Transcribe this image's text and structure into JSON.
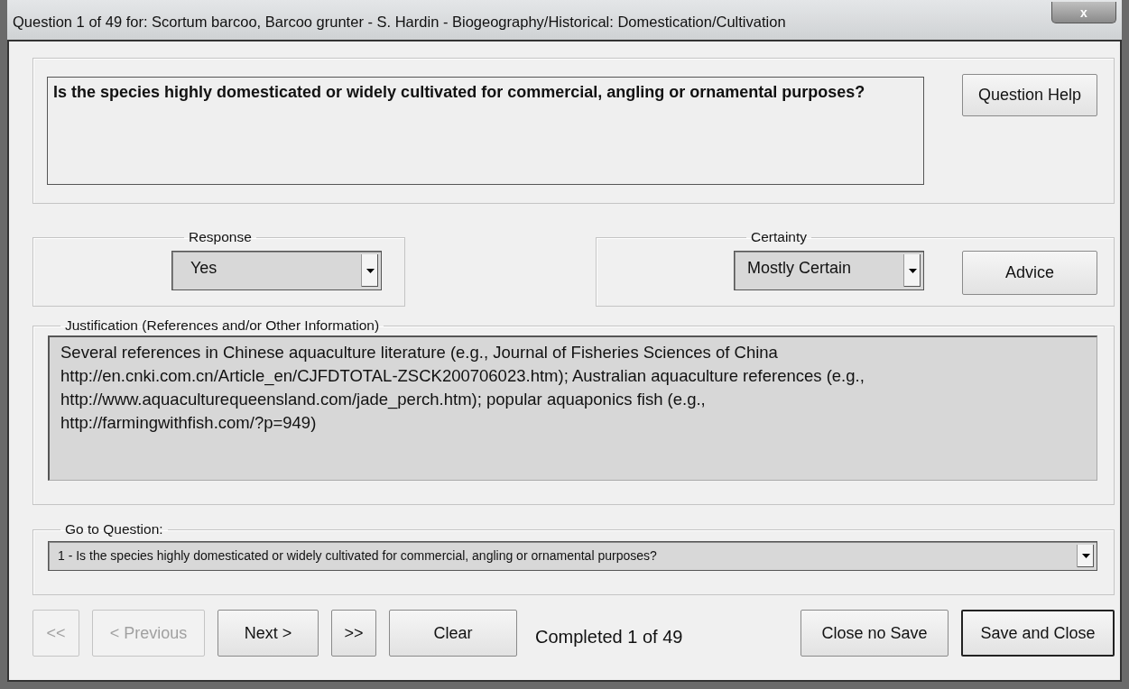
{
  "window": {
    "title": "Question 1 of 49 for: Scortum barcoo, Barcoo grunter - S. Hardin - Biogeography/Historical: Domestication/Cultivation",
    "close": "x"
  },
  "question": {
    "text": "Is the species highly domesticated or widely cultivated for commercial, angling or ornamental purposes?",
    "help_button": "Question Help"
  },
  "response": {
    "label": "Response",
    "value": "Yes"
  },
  "certainty": {
    "label": "Certainty",
    "value": "Mostly Certain",
    "advice_button": "Advice"
  },
  "justification": {
    "label": "Justification (References and/or Other Information)",
    "value": "Several references in Chinese aquaculture literature (e.g., Journal of Fisheries Sciences of China\nhttp://en.cnki.com.cn/Article_en/CJFDTOTAL-ZSCK200706023.htm); Australian aquaculture references (e.g.,\nhttp://www.aquaculturequeensland.com/jade_perch.htm); popular aquaponics fish (e.g.,\nhttp://farmingwithfish.com/?p=949)"
  },
  "goto": {
    "label": "Go to Question:",
    "value": "1 - Is the species highly domesticated or widely cultivated for commercial, angling or ornamental purposes?"
  },
  "nav_buttons": [
    {
      "label": "<<",
      "disabled": true,
      "default": false
    },
    {
      "label": "< Previous",
      "disabled": true,
      "default": false
    },
    {
      "label": "Next >",
      "disabled": false,
      "default": false
    },
    {
      "label": ">>",
      "disabled": false,
      "default": false
    },
    {
      "label": "Clear",
      "disabled": false,
      "default": false
    }
  ],
  "status": "Completed 1 of 49",
  "close_buttons": [
    {
      "label": "Close no Save",
      "disabled": false,
      "default": false
    },
    {
      "label": "Save and Close",
      "disabled": false,
      "default": true
    }
  ]
}
